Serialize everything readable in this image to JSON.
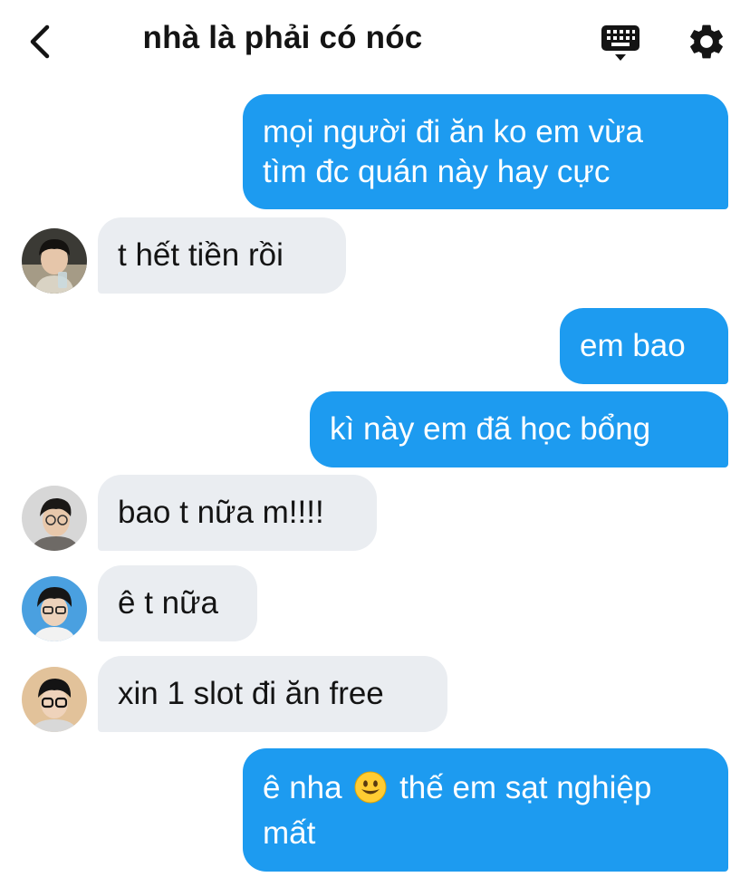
{
  "header": {
    "title": "nhà là phải có nóc",
    "back_icon": "chevron-left-icon",
    "keyboard_icon": "keyboard-icon",
    "settings_icon": "gear-icon"
  },
  "messages": [
    {
      "from": "me",
      "line1": "mọi người đi ăn ko em vừa",
      "line2": "tìm đc quán này hay cực"
    },
    {
      "from": "friend",
      "text": "t hết tiền rồi"
    },
    {
      "from": "me",
      "text": "em bao"
    },
    {
      "from": "me",
      "text": "kì này em đã học bổng"
    },
    {
      "from": "friend",
      "text": "bao t nữa m!!!!"
    },
    {
      "from": "friend",
      "text": "ê t nữa"
    },
    {
      "from": "friend",
      "text": "xin 1 slot đi ăn free"
    },
    {
      "from": "me",
      "line1_a": "ê nha",
      "emoji": "smiling-face-emoji",
      "line1_b": "thế em sạt nghiệp",
      "line2": "mất"
    }
  ],
  "colors": {
    "outgoing": "#1d9bf0",
    "incoming": "#eaedf1",
    "text_dark": "#141414"
  }
}
